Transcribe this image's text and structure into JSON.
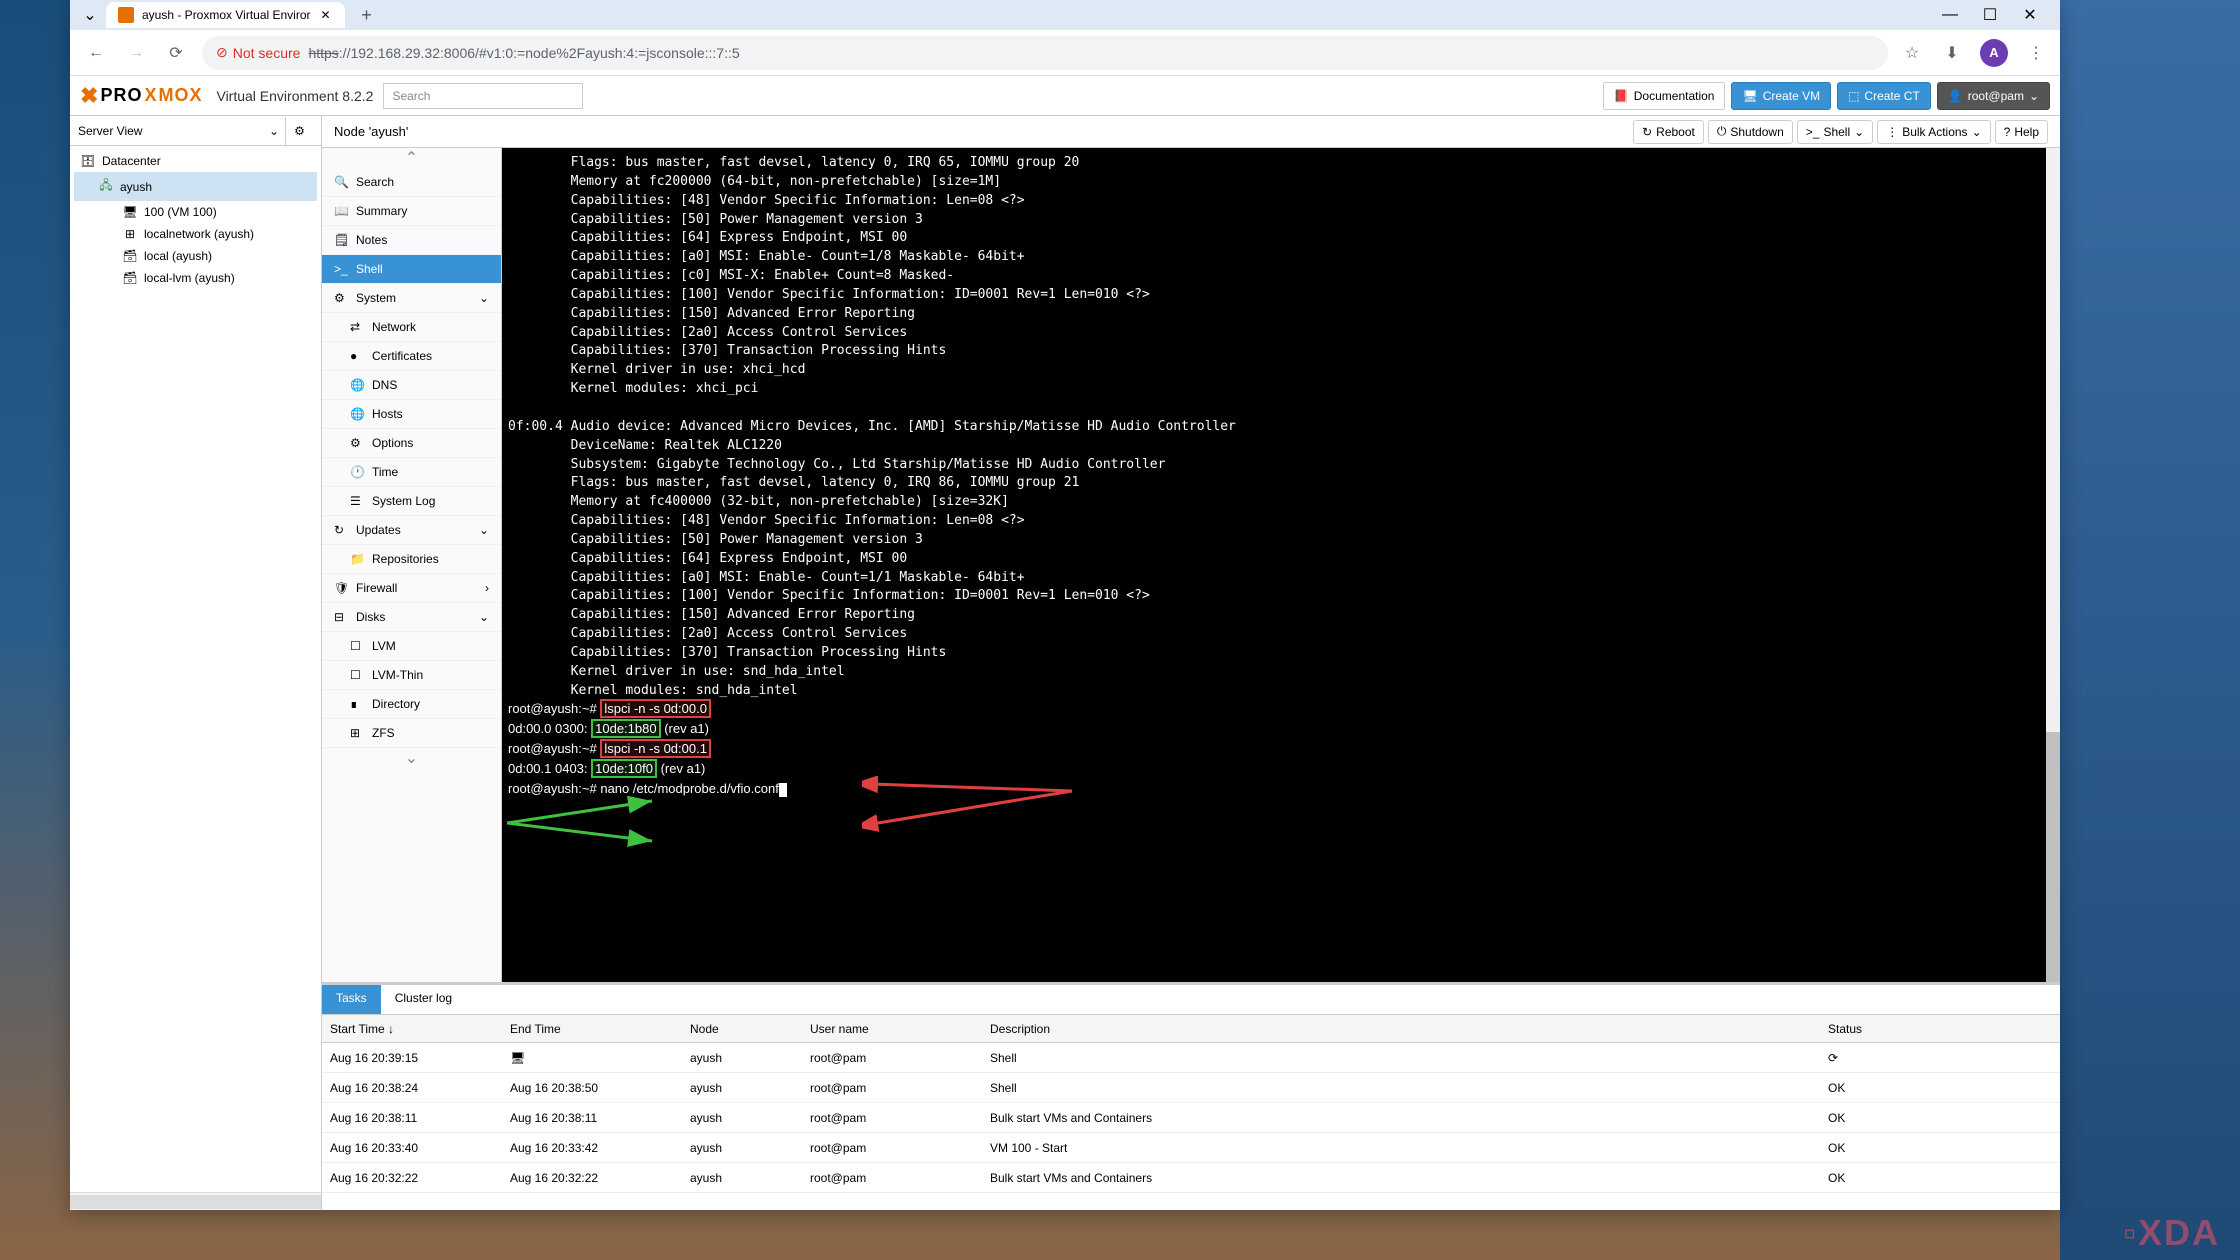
{
  "browser": {
    "tab_title": "ayush - Proxmox Virtual Enviror",
    "url_not_secure": "Not secure",
    "url": "https://192.168.29.32:8006/#v1:0:=node%2Fayush:4:=jsconsole:::7::5"
  },
  "proxmox_header": {
    "product": "PROXMOX",
    "suffix": "Virtual Environment 8.2.2",
    "search_placeholder": "Search",
    "documentation": "Documentation",
    "create_vm": "Create VM",
    "create_ct": "Create CT",
    "user": "root@pam"
  },
  "server_view": {
    "label": "Server View",
    "tree": {
      "datacenter": "Datacenter",
      "node": "ayush",
      "vm": "100 (VM 100)",
      "localnetwork": "localnetwork (ayush)",
      "local": "local (ayush)",
      "local_lvm": "local-lvm (ayush)"
    }
  },
  "node_bar": {
    "title": "Node 'ayush'",
    "reboot": "Reboot",
    "shutdown": "Shutdown",
    "shell": "Shell",
    "bulk_actions": "Bulk Actions",
    "help": "Help"
  },
  "sub_nav": {
    "search": "Search",
    "summary": "Summary",
    "notes": "Notes",
    "shell": "Shell",
    "system": "System",
    "network": "Network",
    "certificates": "Certificates",
    "dns": "DNS",
    "hosts": "Hosts",
    "options": "Options",
    "time": "Time",
    "system_log": "System Log",
    "updates": "Updates",
    "repositories": "Repositories",
    "firewall": "Firewall",
    "disks": "Disks",
    "lvm": "LVM",
    "lvm_thin": "LVM-Thin",
    "directory": "Directory",
    "zfs": "ZFS"
  },
  "terminal_lines": [
    "        Flags: bus master, fast devsel, latency 0, IRQ 65, IOMMU group 20",
    "        Memory at fc200000 (64-bit, non-prefetchable) [size=1M]",
    "        Capabilities: [48] Vendor Specific Information: Len=08 <?>",
    "        Capabilities: [50] Power Management version 3",
    "        Capabilities: [64] Express Endpoint, MSI 00",
    "        Capabilities: [a0] MSI: Enable- Count=1/8 Maskable- 64bit+",
    "        Capabilities: [c0] MSI-X: Enable+ Count=8 Masked-",
    "        Capabilities: [100] Vendor Specific Information: ID=0001 Rev=1 Len=010 <?>",
    "        Capabilities: [150] Advanced Error Reporting",
    "        Capabilities: [2a0] Access Control Services",
    "        Capabilities: [370] Transaction Processing Hints",
    "        Kernel driver in use: xhci_hcd",
    "        Kernel modules: xhci_pci",
    "",
    "0f:00.4 Audio device: Advanced Micro Devices, Inc. [AMD] Starship/Matisse HD Audio Controller",
    "        DeviceName: Realtek ALC1220",
    "        Subsystem: Gigabyte Technology Co., Ltd Starship/Matisse HD Audio Controller",
    "        Flags: bus master, fast devsel, latency 0, IRQ 86, IOMMU group 21",
    "        Memory at fc400000 (32-bit, non-prefetchable) [size=32K]",
    "        Capabilities: [48] Vendor Specific Information: Len=08 <?>",
    "        Capabilities: [50] Power Management version 3",
    "        Capabilities: [64] Express Endpoint, MSI 00",
    "        Capabilities: [a0] MSI: Enable- Count=1/1 Maskable- 64bit+",
    "        Capabilities: [100] Vendor Specific Information: ID=0001 Rev=1 Len=010 <?>",
    "        Capabilities: [150] Advanced Error Reporting",
    "        Capabilities: [2a0] Access Control Services",
    "        Capabilities: [370] Transaction Processing Hints",
    "        Kernel driver in use: snd_hda_intel",
    "        Kernel modules: snd_hda_intel",
    ""
  ],
  "terminal_cmds": {
    "prompt1": "root@ayush:~# ",
    "cmd1": "lspci -n -s 0d:00.0",
    "line1a": "0d:00.0 0300: ",
    "id1": "10de:1b80",
    "rev1": " (rev a1)",
    "prompt2": "root@ayush:~# ",
    "cmd2": "lspci -n -s 0d:00.1",
    "line2a": "0d:00.1 0403: ",
    "id2": "10de:10f0",
    "rev2": " (rev a1)",
    "prompt3": "root@ayush:~# ",
    "cmd3": "nano /etc/modprobe.d/vfio.conf"
  },
  "log_panel": {
    "tab_tasks": "Tasks",
    "tab_cluster": "Cluster log",
    "headers": {
      "start": "Start Time ↓",
      "end": "End Time",
      "node": "Node",
      "user": "User name",
      "desc": "Description",
      "status": "Status"
    },
    "rows": [
      {
        "start": "Aug 16 20:39:15",
        "end": "",
        "end_icon": true,
        "node": "ayush",
        "user": "root@pam",
        "desc": "Shell",
        "status": ""
      },
      {
        "start": "Aug 16 20:38:24",
        "end": "Aug 16 20:38:50",
        "node": "ayush",
        "user": "root@pam",
        "desc": "Shell",
        "status": "OK"
      },
      {
        "start": "Aug 16 20:38:11",
        "end": "Aug 16 20:38:11",
        "node": "ayush",
        "user": "root@pam",
        "desc": "Bulk start VMs and Containers",
        "status": "OK"
      },
      {
        "start": "Aug 16 20:33:40",
        "end": "Aug 16 20:33:42",
        "node": "ayush",
        "user": "root@pam",
        "desc": "VM 100 - Start",
        "status": "OK"
      },
      {
        "start": "Aug 16 20:32:22",
        "end": "Aug 16 20:32:22",
        "node": "ayush",
        "user": "root@pam",
        "desc": "Bulk start VMs and Containers",
        "status": "OK"
      }
    ]
  },
  "watermark": "XDA"
}
